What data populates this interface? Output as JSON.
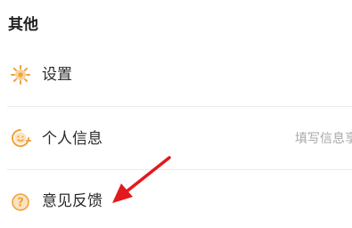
{
  "section": {
    "title": "其他"
  },
  "items": [
    {
      "label": "设置",
      "icon": "gear-icon"
    },
    {
      "label": "个人信息",
      "value": "填写信息享",
      "icon": "smile-face-icon"
    },
    {
      "label": "意见反馈",
      "icon": "question-circle-icon"
    }
  ],
  "colors": {
    "icon_accent": "#f0a33a",
    "arrow": "#e3191d"
  }
}
